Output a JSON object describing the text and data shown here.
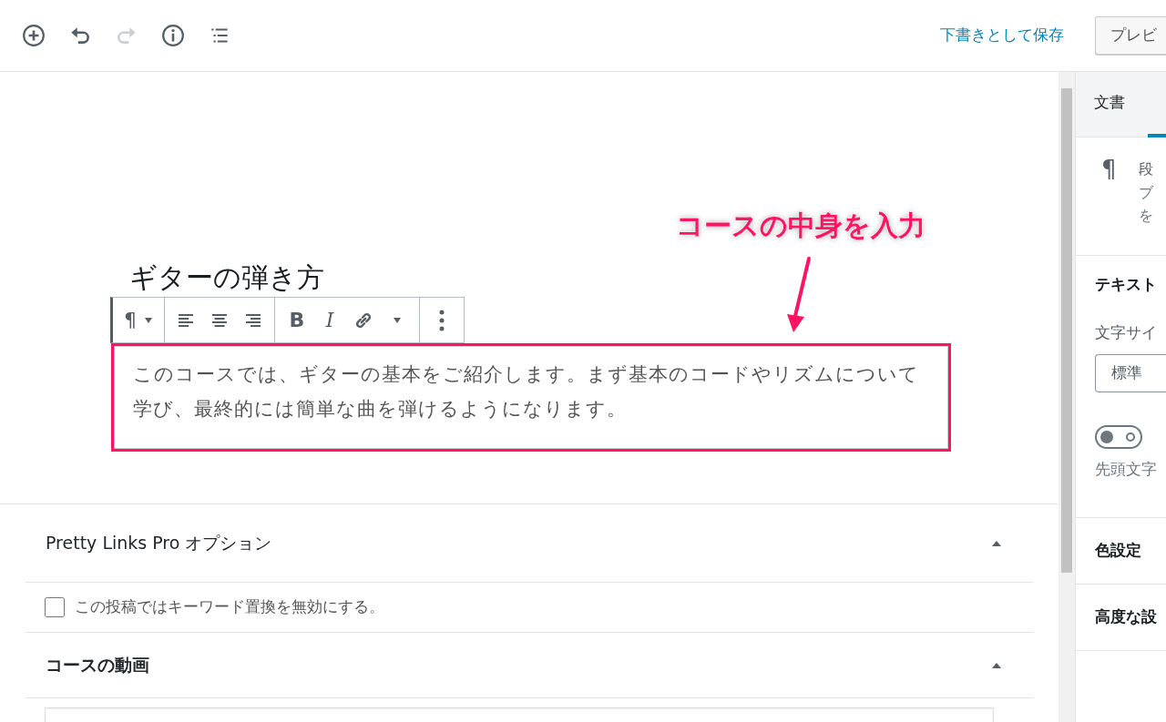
{
  "toolbar": {
    "icons": [
      {
        "kind": "add",
        "disabled": false
      },
      {
        "kind": "undo",
        "disabled": false
      },
      {
        "kind": "redo",
        "disabled": true
      },
      {
        "kind": "info",
        "disabled": false
      },
      {
        "kind": "outline",
        "disabled": false
      }
    ],
    "save_draft": "下書きとして保存",
    "preview": "プレビ"
  },
  "editor": {
    "title": "ギターの弾き方",
    "block_toolbar": [
      "¶",
      "B",
      "I"
    ],
    "paragraph": "このコースでは、ギターの基本をご紹介します。まず基本のコードやリズムについて学び、最終的には簡単な曲を弾けるようになります。",
    "annotation": "コースの中身を入力"
  },
  "meta_boxes": [
    {
      "title": "Pretty Links Pro オプション",
      "expanded": true,
      "kind": "checkbox",
      "label": "この投稿ではキーワード置換を無効にする。",
      "checked": false
    },
    {
      "title": "コースの動画",
      "expanded": true,
      "kind": "textarea"
    }
  ],
  "sidebar": {
    "tabs": [
      {
        "label": "文書",
        "selected": false
      },
      {
        "selected": true
      }
    ],
    "block_icon": "¶",
    "block_name": "段",
    "block_desc": [
      "ブ",
      "を"
    ],
    "sections": [
      {
        "title": "テキスト",
        "kind": "text_settings",
        "font_size_label": "文字サイ",
        "font_size": "標準",
        "drop_cap_on": false,
        "drop_cap_label": "先頭文字"
      },
      {
        "title": "色設定",
        "kind": "plain"
      },
      {
        "title": "高度な設",
        "kind": "plain"
      }
    ]
  }
}
